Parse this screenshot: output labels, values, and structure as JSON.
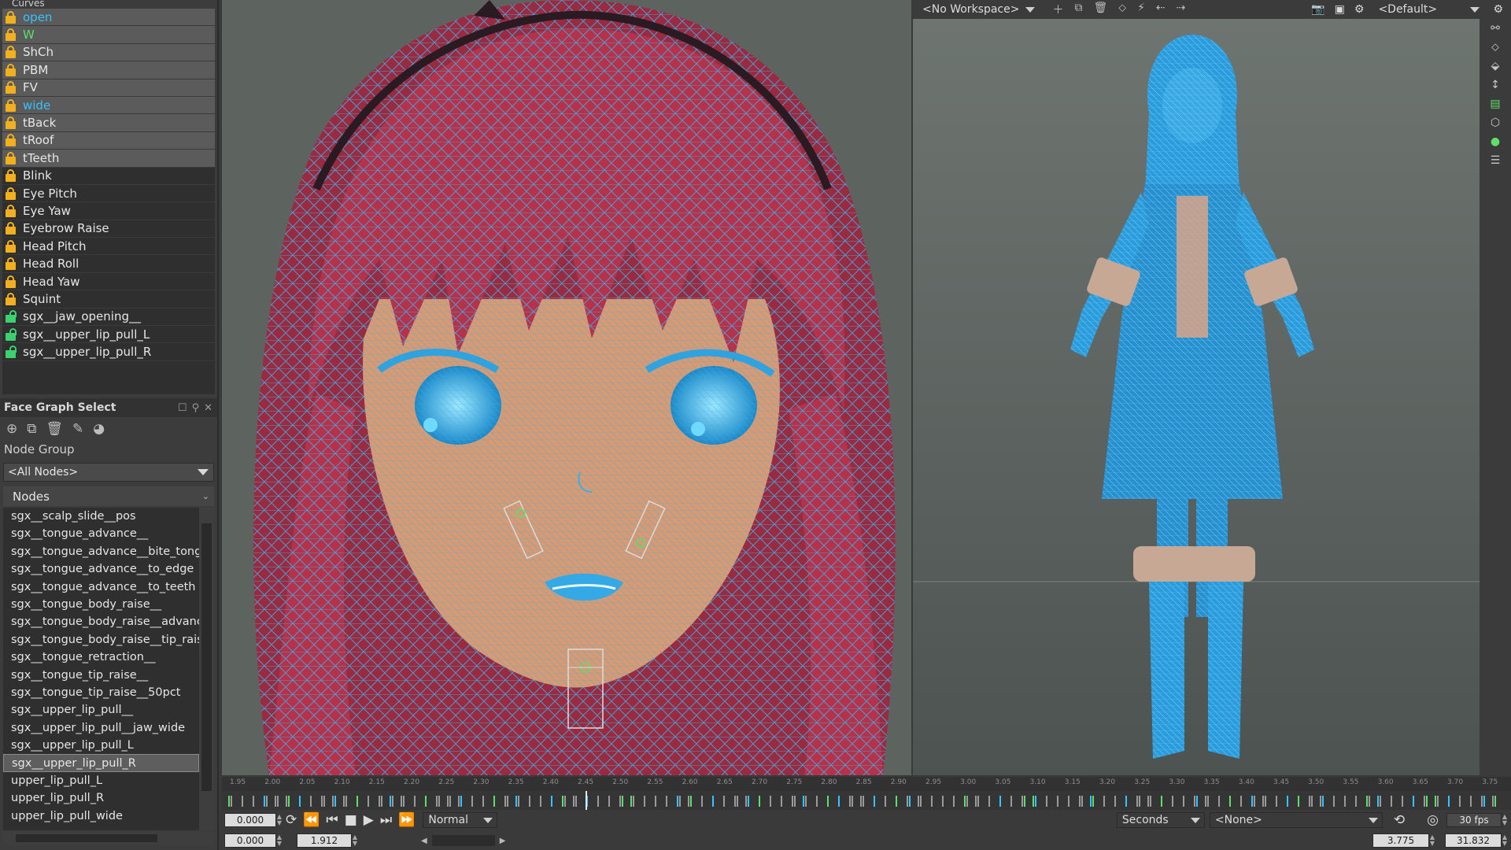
{
  "curves_panel": {
    "title": "Curves",
    "items": [
      {
        "label": "open",
        "selected": true,
        "label_color": "#34c4ff",
        "lock": "yellow"
      },
      {
        "label": "W",
        "selected": true,
        "label_color": "#5ee06a",
        "lock": "yellow"
      },
      {
        "label": "ShCh",
        "selected": true,
        "label_color": "#e6e6e6",
        "lock": "yellow"
      },
      {
        "label": "PBM",
        "selected": true,
        "label_color": "#e6e6e6",
        "lock": "yellow"
      },
      {
        "label": "FV",
        "selected": true,
        "label_color": "#e6e6e6",
        "lock": "yellow"
      },
      {
        "label": "wide",
        "selected": true,
        "label_color": "#34c4ff",
        "lock": "yellow"
      },
      {
        "label": "tBack",
        "selected": true,
        "label_color": "#e6e6e6",
        "lock": "yellow"
      },
      {
        "label": "tRoof",
        "selected": true,
        "label_color": "#e6e6e6",
        "lock": "yellow"
      },
      {
        "label": "tTeeth",
        "selected": true,
        "label_color": "#e6e6e6",
        "lock": "yellow"
      },
      {
        "label": "Blink",
        "selected": false,
        "label_color": "#e6e6e6",
        "lock": "yellow"
      },
      {
        "label": "Eye Pitch",
        "selected": false,
        "label_color": "#e6e6e6",
        "lock": "yellow"
      },
      {
        "label": "Eye Yaw",
        "selected": false,
        "label_color": "#e6e6e6",
        "lock": "yellow"
      },
      {
        "label": "Eyebrow Raise",
        "selected": false,
        "label_color": "#e6e6e6",
        "lock": "yellow"
      },
      {
        "label": "Head Pitch",
        "selected": false,
        "label_color": "#e6e6e6",
        "lock": "yellow"
      },
      {
        "label": "Head Roll",
        "selected": false,
        "label_color": "#e6e6e6",
        "lock": "yellow"
      },
      {
        "label": "Head Yaw",
        "selected": false,
        "label_color": "#e6e6e6",
        "lock": "yellow"
      },
      {
        "label": "Squint",
        "selected": false,
        "label_color": "#e6e6e6",
        "lock": "yellow"
      },
      {
        "label": "sgx__jaw_opening__",
        "selected": false,
        "label_color": "#e6e6e6",
        "lock": "green"
      },
      {
        "label": "sgx__upper_lip_pull_L",
        "selected": false,
        "label_color": "#e6e6e6",
        "lock": "green"
      },
      {
        "label": "sgx__upper_lip_pull_R",
        "selected": false,
        "label_color": "#e6e6e6",
        "lock": "green"
      }
    ]
  },
  "face_graph": {
    "title": "Face Graph Select",
    "node_group_label": "Node Group",
    "node_group_value": "<All Nodes>",
    "nodes_header": "Nodes",
    "nodes": [
      "sgx__scalp_slide__pos",
      "sgx__tongue_advance__",
      "sgx__tongue_advance__bite_tongue",
      "sgx__tongue_advance__to_edge",
      "sgx__tongue_advance__to_teeth",
      "sgx__tongue_body_raise__",
      "sgx__tongue_body_raise__advance",
      "sgx__tongue_body_raise__tip_raise",
      "sgx__tongue_retraction__",
      "sgx__tongue_tip_raise__",
      "sgx__tongue_tip_raise__50pct",
      "sgx__upper_lip_pull__",
      "sgx__upper_lip_pull__jaw_wide",
      "sgx__upper_lip_pull_L",
      "sgx__upper_lip_pull_R",
      "upper_lip_pull_L",
      "upper_lip_pull_R",
      "upper_lip_pull_wide"
    ],
    "selected_node": "sgx__upper_lip_pull_R"
  },
  "viewport_toolbar": {
    "workspace": "<No Workspace>",
    "camera": "<Default>"
  },
  "timeline": {
    "ticks": [
      "1.95",
      "2.00",
      "2.05",
      "2.10",
      "2.15",
      "2.20",
      "2.25",
      "2.30",
      "2.35",
      "2.40",
      "2.45",
      "2.50",
      "2.55",
      "2.60",
      "2.65",
      "2.70",
      "2.75",
      "2.80",
      "2.85",
      "2.90",
      "2.95",
      "3.00",
      "3.05",
      "3.10",
      "3.15",
      "3.20",
      "3.25",
      "3.30",
      "3.35",
      "3.40",
      "3.45",
      "3.50",
      "3.55",
      "3.60",
      "3.65",
      "3.70",
      "3.75"
    ],
    "current_time": "0.000",
    "range_start": "0.000",
    "range_end": "1.912",
    "play_mode": "Normal",
    "time_units": "Seconds",
    "audio": "<None>",
    "fps": "30 fps",
    "view_start": "3.775",
    "view_end": "31.832"
  },
  "colors": {
    "hair": "#b5324a",
    "skin": "#d79a73",
    "wire": "#3aaee8",
    "body_blue": "#2b9cdb"
  },
  "icons": [
    "lock-icon",
    "new-icon",
    "copy-icon",
    "trash-icon",
    "pencil-icon",
    "palette-icon",
    "settings-icon",
    "camera-icon",
    "play-icon",
    "loop-icon"
  ]
}
